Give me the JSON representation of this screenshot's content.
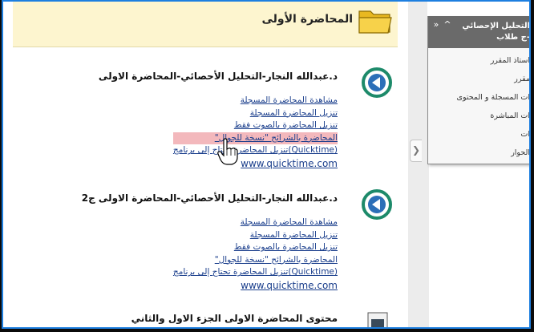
{
  "header": {
    "title": "المحاضرة الأولى",
    "icon": "folder-icon"
  },
  "sections": [
    {
      "title": "د.عبدالله النجار-التحليل الأحصائي-المحاضرة الاولى",
      "links": [
        "مشاهدة المحاضرة المسجلة",
        "تنزيل المحاضرة المسجلة",
        "تنزيل المحاضرة بالصوت فقط",
        "المحاضرة بالشرائح \"نسخة للجوال\""
      ],
      "qt_link": "(Quicktime)تنزيل المحاضرة تحتاج إلى برنامج",
      "url": "www.quicktime.com"
    },
    {
      "title": "د.عبدالله النجار-التحليل الأحصائي-المحاضرة الاولى ج2",
      "links": [
        "مشاهدة المحاضرة المسجلة",
        "تنزيل المحاضرة المسجلة",
        "تنزيل المحاضرة بالصوت فقط",
        "المحاضرة بالشرائح \"نسخة للجوال\""
      ],
      "qt_link": "(Quicktime)تنزيل المحاضرة تحتاج إلى برنامج",
      "url": "www.quicktime.com"
    },
    {
      "title": "محتوى المحاضرة الاولى الجزء الاول والثاني"
    }
  ],
  "side_panel": {
    "title": "التحليل الإحصائي -ج طلاب",
    "collapse_symbol": "»",
    "up_symbol": "^",
    "items": [
      "استاذ المقرر",
      "مقرر",
      "ات المسجلة و المحتوى",
      "ات المباشرة",
      "ات",
      "الحوار"
    ]
  },
  "colors": {
    "header_bg": "#fdf5cf",
    "link": "#1a3e8c",
    "highlight": "#f3b8bc",
    "play_ring": "#1d8a6a",
    "panel_head": "#6a6a6a",
    "frame": "#1d7fe0"
  }
}
